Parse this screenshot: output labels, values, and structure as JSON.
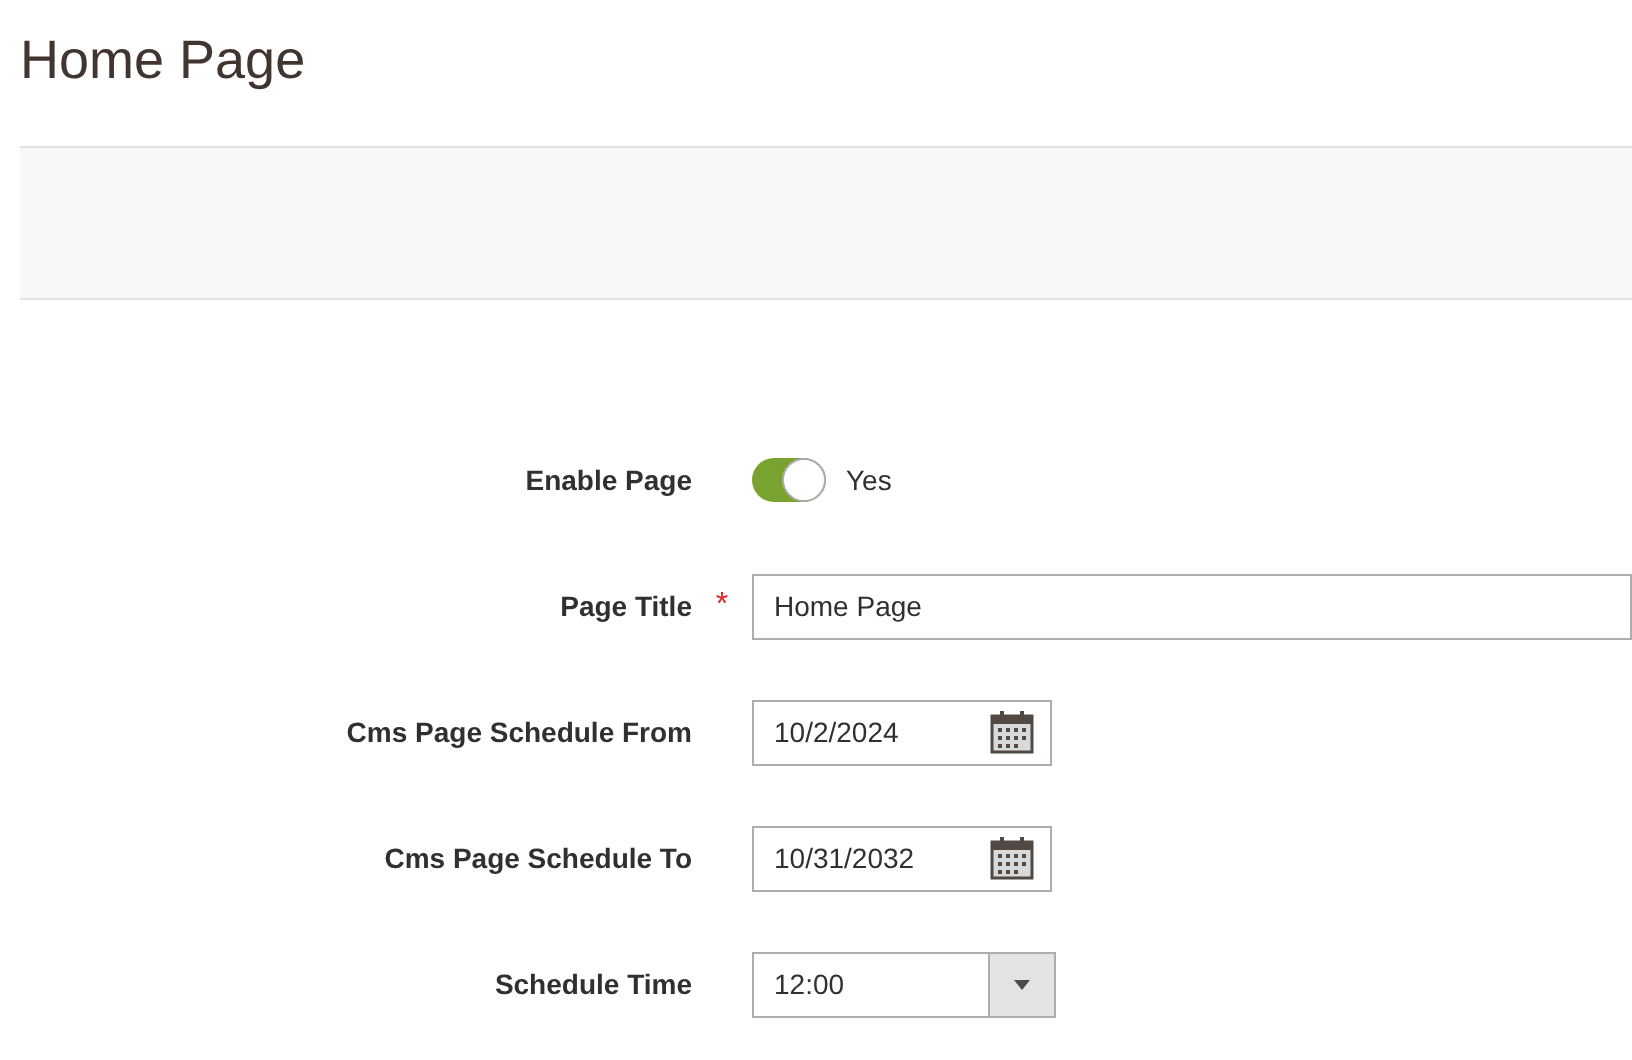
{
  "page": {
    "title": "Home Page"
  },
  "fields": [
    {
      "kind": "toggle",
      "label": "Enable Page",
      "on": true,
      "value": "Yes"
    },
    {
      "kind": "text",
      "label": "Page Title",
      "required_mark": "*",
      "value": "Home Page"
    },
    {
      "kind": "date",
      "label": "Cms Page Schedule From",
      "value": "10/2/2024"
    },
    {
      "kind": "date",
      "label": "Cms Page Schedule To",
      "value": "10/31/2032"
    },
    {
      "kind": "select",
      "label": "Schedule Time",
      "value": "12:00"
    }
  ]
}
